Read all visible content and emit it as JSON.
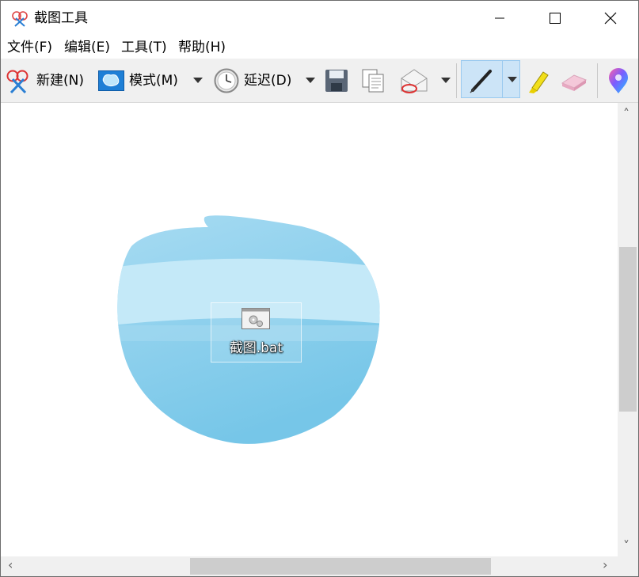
{
  "window": {
    "title": "截图工具",
    "controls": [
      "minimize-icon",
      "maximize-icon",
      "close-icon"
    ]
  },
  "menu": {
    "file": "文件(F)",
    "edit": "编辑(E)",
    "tools": "工具(T)",
    "help": "帮助(H)"
  },
  "toolbar": {
    "new_label": "新建(N)",
    "mode_label": "模式(M)",
    "delay_label": "延迟(D)",
    "icons": [
      "scissors-icon",
      "mode-icon",
      "clock-icon",
      "save-icon",
      "copy-icon",
      "email-icon",
      "pen-icon",
      "highlighter-icon",
      "eraser-icon",
      "paint3d-icon"
    ],
    "selected_tool": "pen"
  },
  "canvas": {
    "file_name": "截图.bat",
    "file_icon": "batch-file-gear-icon",
    "blob_color": "#8fd0ec"
  },
  "scrollbars": {
    "left_arrow": "‹",
    "right_arrow": "›",
    "up_arrow": "˄",
    "down_arrow": "˅"
  }
}
